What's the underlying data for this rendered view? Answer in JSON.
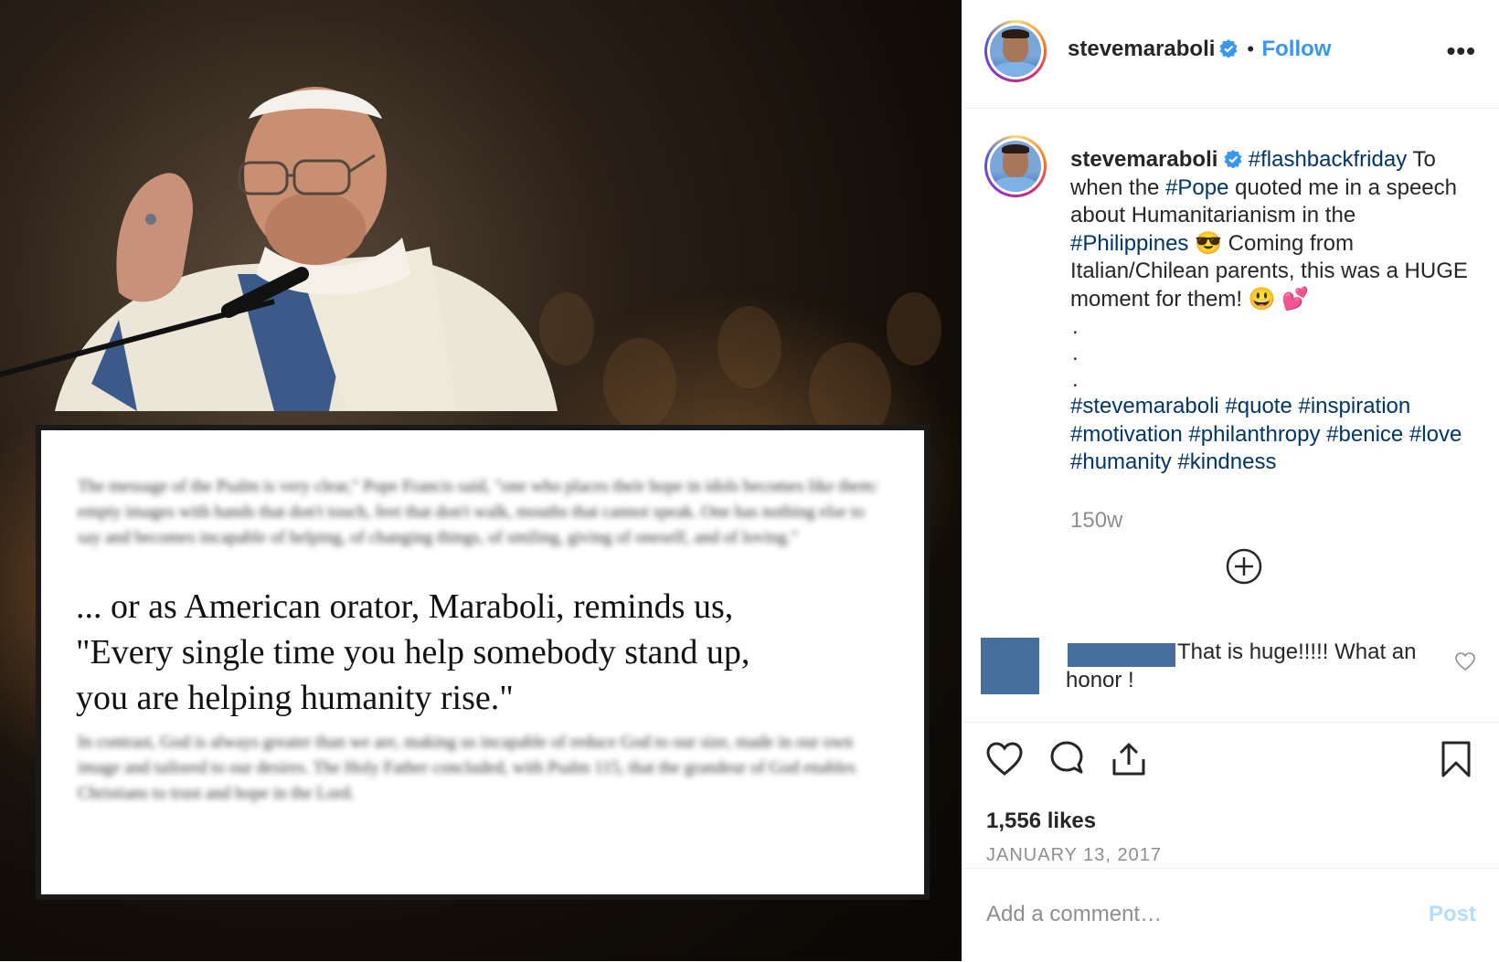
{
  "post_image": {
    "quote_lines": [
      "... or as American orator, Maraboli, reminds us,",
      "\"Every single time you help somebody stand up,",
      "you are helping humanity rise.\""
    ],
    "blurred_top": "The message of the Psalm is very clear,\" Pope Francis said, \"one who places their hope in idols becomes like them: empty images with hands that don't touch, feet that don't walk, mouths that cannot speak. One has nothing else to say and becomes incapable of helping, of changing things, of smiling, giving of oneself, and of loving.\"",
    "blurred_bottom": "In contrast, God is always greater than we are, making us incapable of reduce God to our size, made in our own image and tailored to our desires. The Holy Father concluded, with Psalm 115, that the grandeur of God enables Christians to trust and hope in the Lord."
  },
  "header": {
    "username": "stevemaraboli",
    "separator": "•",
    "follow_label": "Follow",
    "more_label": "•••"
  },
  "caption": {
    "username": "stevemaraboli",
    "tag1": "#flashbackfriday",
    "text1": " To when the ",
    "tag2": "#Pope",
    "text2": " quoted me in a speech about Humanitarianism in the ",
    "tag3": "#Philippines",
    "emoji1": "😎",
    "text3": "  Coming from Italian/Chilean parents, this was a HUGE moment for them! ",
    "emoji2": "😃",
    "emoji3": "💕",
    "dots": [
      ".",
      ".",
      "."
    ],
    "hashtags": "#stevemaraboli #quote #inspiration #motivation #philanthropy #benice #love #humanity #kindness",
    "time_ago": "150w"
  },
  "comment": {
    "text": "That is huge!!!!! What an honor !"
  },
  "stats": {
    "likes": "1,556 likes",
    "date": "JANUARY 13, 2017"
  },
  "add_comment": {
    "placeholder": "Add a comment…",
    "post_label": "Post"
  },
  "colors": {
    "link_blue": "#3897f0",
    "hashtag": "#003569",
    "muted": "#8e8e8e",
    "redaction": "#476f9d"
  }
}
